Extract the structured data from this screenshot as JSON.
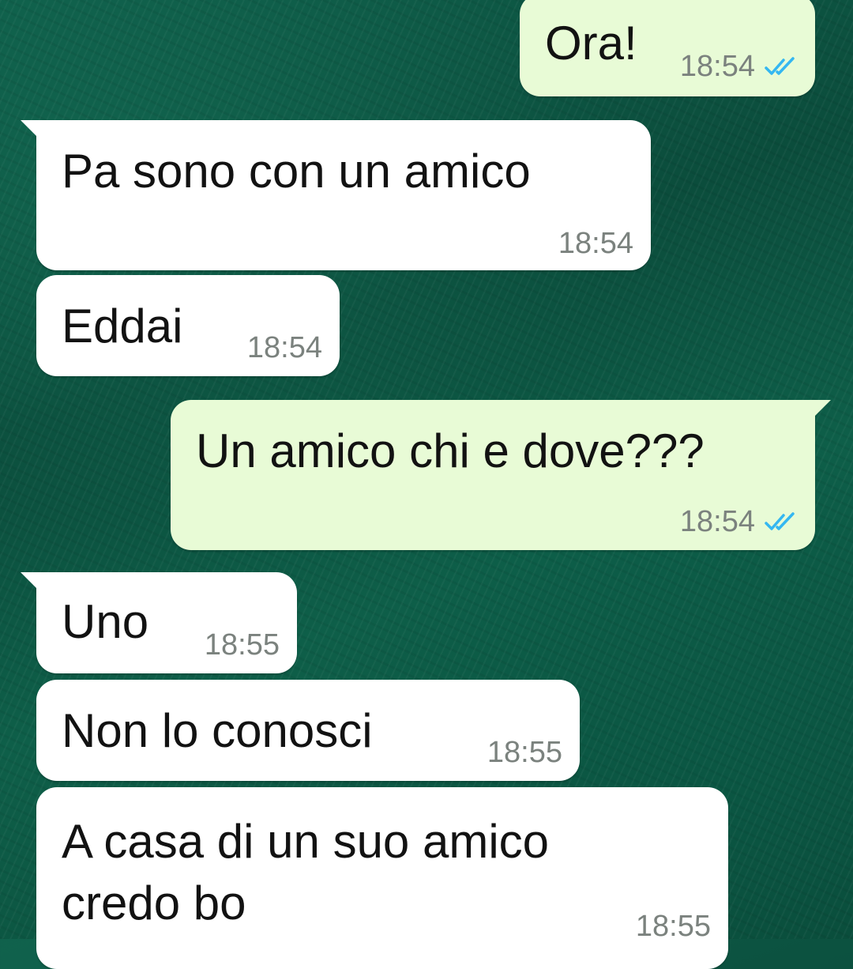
{
  "messages": [
    {
      "direction": "outgoing",
      "text": "Ora!",
      "time": "18:54",
      "status": "read",
      "status_icon": "double-check-icon"
    },
    {
      "direction": "incoming",
      "text": "Pa sono con un amico",
      "time": "18:54"
    },
    {
      "direction": "incoming",
      "text": "Eddai",
      "time": "18:54"
    },
    {
      "direction": "outgoing",
      "text": "Un amico chi e dove???",
      "time": "18:54",
      "status": "read",
      "status_icon": "double-check-icon"
    },
    {
      "direction": "incoming",
      "text": "Uno",
      "time": "18:55"
    },
    {
      "direction": "incoming",
      "text": "Non lo conosci",
      "time": "18:55"
    },
    {
      "direction": "incoming",
      "text": "A casa di un suo amico\ncredo bo",
      "time": "18:55"
    }
  ],
  "colors": {
    "incoming_bubble": "#ffffff",
    "outgoing_bubble": "#e8fbd6",
    "read_ticks": "#34b7f1",
    "timestamp": "#7b827e"
  }
}
